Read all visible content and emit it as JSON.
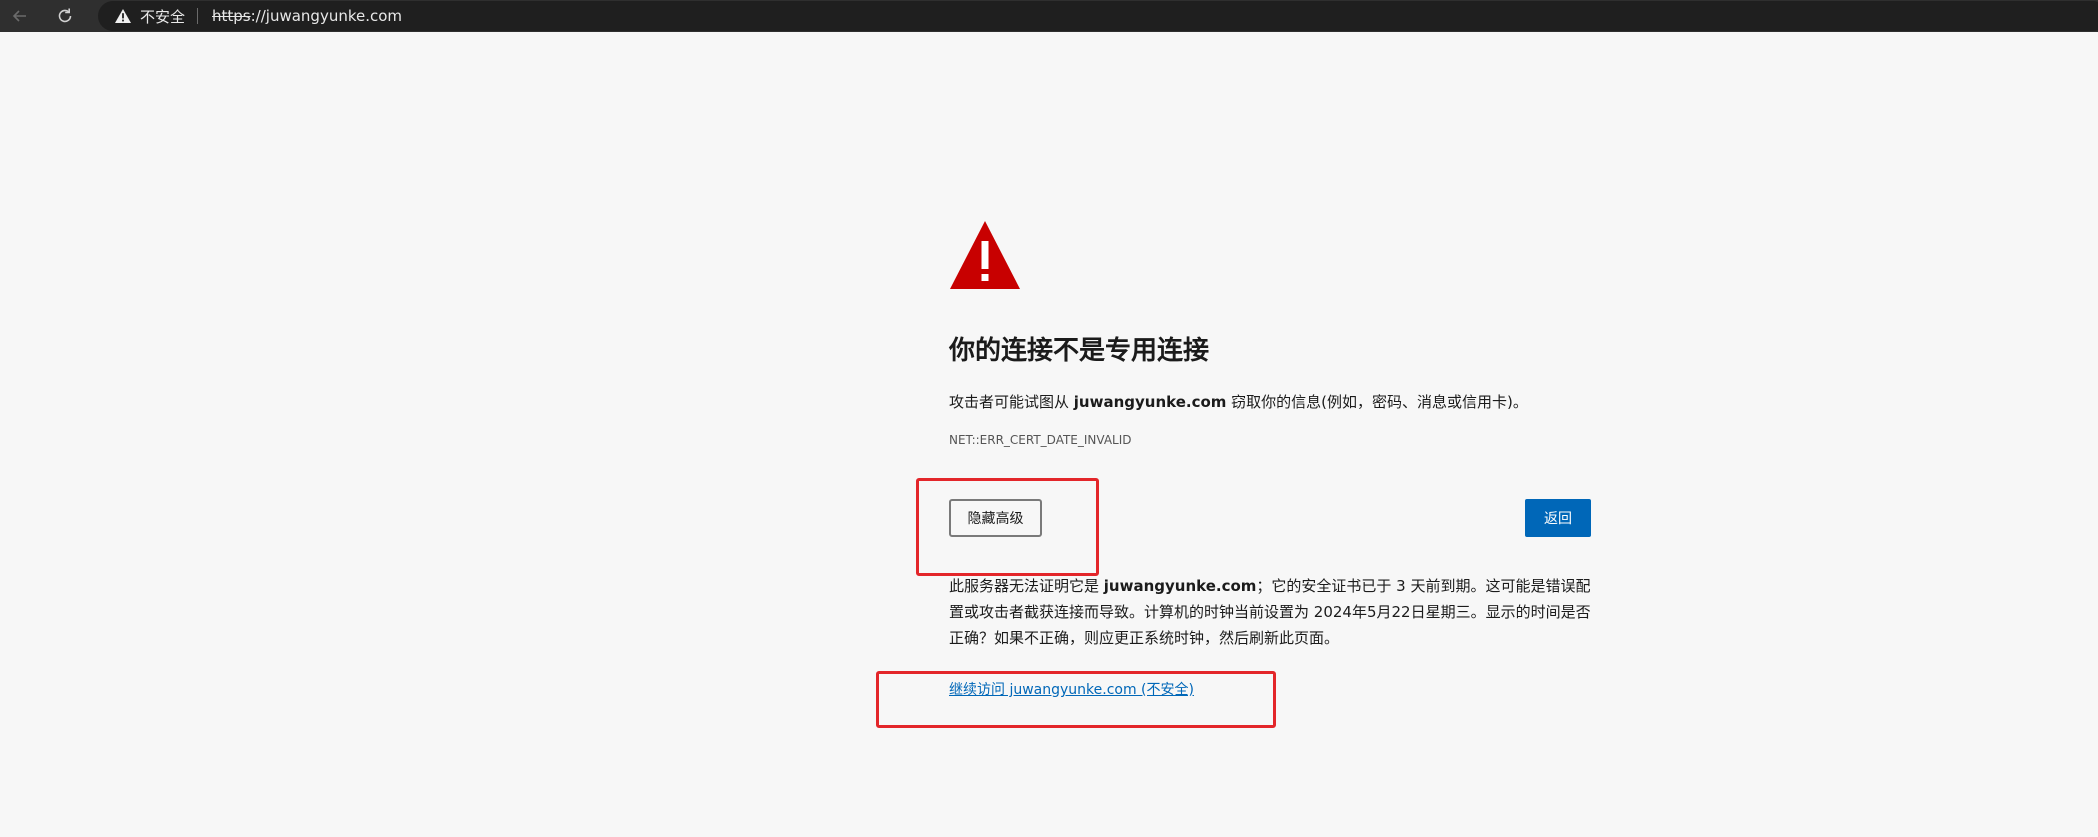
{
  "browser": {
    "security_label": "不安全",
    "url_scheme": "https",
    "url_rest": "://juwangyunke.com"
  },
  "page": {
    "headline": "你的连接不是专用连接",
    "desc_before": "攻击者可能试图从 ",
    "desc_host": "juwangyunke.com",
    "desc_after": " 窃取你的信息(例如，密码、消息或信用卡)。",
    "error_code": "NET::ERR_CERT_DATE_INVALID",
    "hide_advanced_label": "隐藏高级",
    "back_label": "返回",
    "details_before": "此服务器无法证明它是 ",
    "details_host": "juwangyunke.com",
    "details_after": "；它的安全证书已于 3 天前到期。这可能是错误配置或攻击者截获连接而导致。计算机的时钟当前设置为 2024年5月22日星期三。显示的时间是否正确？如果不正确，则应更正系统时钟，然后刷新此页面。",
    "proceed_link": "继续访问 juwangyunke.com (不安全)"
  },
  "colors": {
    "warning_red": "#c80000",
    "button_blue": "#0067b8",
    "annotation_red": "#e3262a"
  }
}
